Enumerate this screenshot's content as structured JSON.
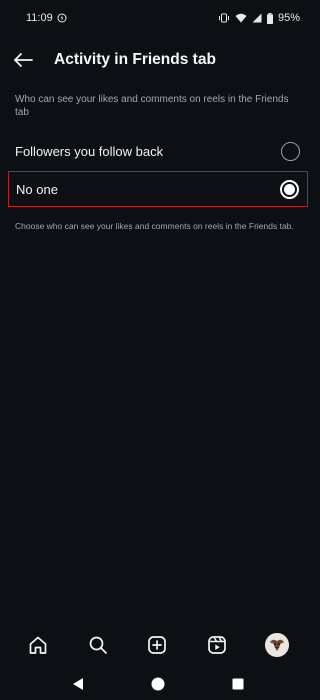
{
  "status_bar": {
    "time": "11:09",
    "battery": "95%"
  },
  "header": {
    "title": "Activity in Friends tab"
  },
  "section": {
    "description": "Who can see your likes and comments on reels in the Friends tab"
  },
  "options": [
    {
      "label": "Followers you follow back",
      "selected": false
    },
    {
      "label": "No one",
      "selected": true
    }
  ],
  "footer_note": "Choose who can see your likes and comments on reels in the Friends tab.",
  "bottom_nav": {
    "items": [
      "home-icon",
      "search-icon",
      "create-icon",
      "reels-icon",
      "profile-avatar"
    ]
  },
  "system_nav": {
    "items": [
      "back-triangle-icon",
      "home-circle-icon",
      "recents-square-icon"
    ]
  },
  "colors": {
    "background": "#0c0f14",
    "highlight_border": "#b3232a",
    "secondary_text": "#a3a8b0"
  }
}
